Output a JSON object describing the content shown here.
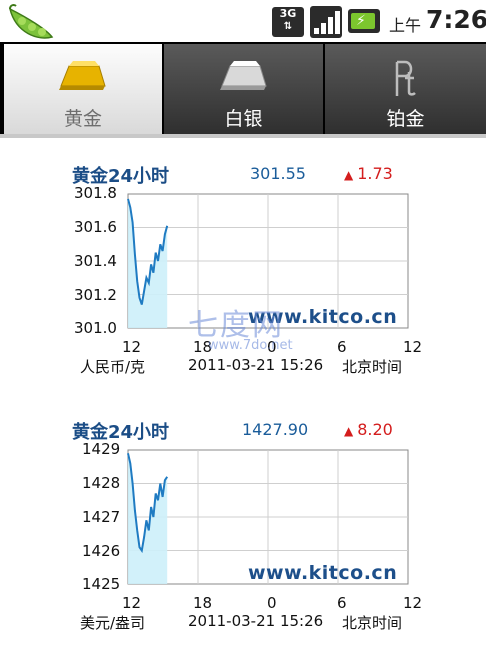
{
  "status_bar": {
    "network": "3G",
    "ampm": "上午",
    "time": "7:26",
    "colors": {
      "battery": "#7cc62e"
    }
  },
  "tabs": [
    {
      "label": "黄金",
      "active": true,
      "icon": "gold-bar-icon"
    },
    {
      "label": "白银",
      "active": false,
      "icon": "silver-bar-icon"
    },
    {
      "label": "铂金",
      "active": false,
      "icon": "platinum-pt-icon"
    }
  ],
  "charts": [
    {
      "title": "黄金24小时",
      "price": "301.55",
      "change": "1.73",
      "unit": "人民币/克",
      "datetime": "2011-03-21 15:26",
      "timezone": "北京时间",
      "watermark": "www.kitco.cn",
      "yticks": [
        "301.8",
        "301.6",
        "301.4",
        "301.2",
        "301.0"
      ],
      "xticks": [
        "12",
        "18",
        "0",
        "6",
        "12"
      ]
    },
    {
      "title": "黄金24小时",
      "price": "1427.90",
      "change": "8.20",
      "unit": "美元/盎司",
      "datetime": "2011-03-21 15:26",
      "timezone": "北京时间",
      "watermark": "www.kitco.cn",
      "yticks": [
        "1429",
        "1428",
        "1427",
        "1426",
        "1425"
      ],
      "xticks": [
        "12",
        "18",
        "0",
        "6",
        "12"
      ]
    }
  ],
  "overlay": {
    "logo_text": "七度网",
    "logo_url": "www.7do.net"
  },
  "chart_data": [
    {
      "type": "area",
      "title": "黄金24小时",
      "xlabel": "",
      "ylabel": "",
      "ylim": [
        301.0,
        301.8
      ],
      "x_ticks": [
        "12",
        "18",
        "0",
        "6",
        "12"
      ],
      "grid": true,
      "series": [
        {
          "values": [
            301.77,
            301.72,
            301.63,
            301.44,
            301.28,
            301.18,
            301.14,
            301.22,
            301.3,
            301.27,
            301.38,
            301.33,
            301.45,
            301.4,
            301.5,
            301.46,
            301.56,
            301.61
          ]
        }
      ]
    },
    {
      "type": "area",
      "title": "黄金24小时",
      "xlabel": "",
      "ylabel": "",
      "ylim": [
        1425,
        1429
      ],
      "x_ticks": [
        "12",
        "18",
        "0",
        "6",
        "12"
      ],
      "grid": true,
      "series": [
        {
          "values": [
            1428.9,
            1428.6,
            1428.0,
            1427.2,
            1426.6,
            1426.1,
            1426.0,
            1426.4,
            1426.9,
            1426.6,
            1427.3,
            1427.0,
            1427.7,
            1427.5,
            1428.0,
            1427.6,
            1428.1,
            1428.2
          ]
        }
      ]
    }
  ]
}
